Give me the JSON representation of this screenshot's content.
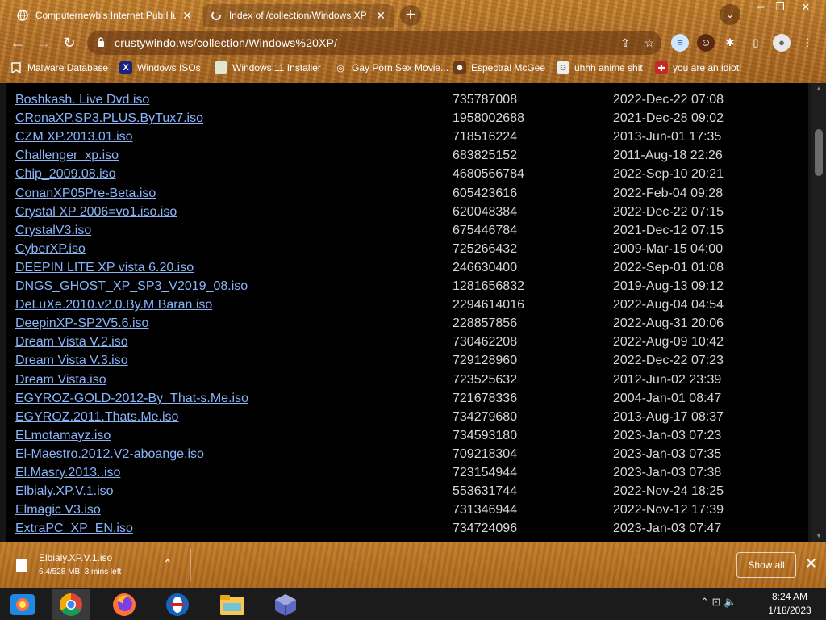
{
  "window": {
    "minimize": "─",
    "restore": "❐",
    "close": "✕"
  },
  "tabs": [
    {
      "title": "Computernewb's Internet Pub Hu",
      "close": "✕",
      "favicon": "globe-icon"
    },
    {
      "title": "Index of /collection/Windows XP",
      "close": "✕",
      "favicon": "loading-icon"
    }
  ],
  "toolbar": {
    "new_tab": "+",
    "tab_search": "⌄",
    "back": "←",
    "forward": "→",
    "reload": "↻",
    "url": "crustywindo.ws/collection/Windows%20XP/",
    "share": "⇪",
    "star": "☆",
    "extensions": "✱",
    "sidebar": "▯",
    "profile": "●",
    "menu": "⋮"
  },
  "bookmarks": [
    {
      "label": "Malware Database",
      "icon": "bookmark-icon"
    },
    {
      "label": "Windows ISOs",
      "icon": "x-logo-icon"
    },
    {
      "label": "Windows 11 Installer",
      "icon": "image-icon"
    },
    {
      "label": "Gay Porn Sex Movie...",
      "icon": "globe-icon"
    },
    {
      "label": "Espectral McGee",
      "icon": "avatar-icon"
    },
    {
      "label": "uhhh anime shit",
      "icon": "avatar-icon"
    },
    {
      "label": "you are an idiot!",
      "icon": "flag-icon"
    }
  ],
  "listing": [
    {
      "name": "Boshkash. Live Dvd.iso",
      "size": "735787008",
      "date": "2022-Dec-22 07:08"
    },
    {
      "name": "CRonaXP.SP3.PLUS.ByTux7.iso",
      "size": "1958002688",
      "date": "2021-Dec-28 09:02"
    },
    {
      "name": "CZM XP.2013.01.iso",
      "size": "718516224",
      "date": "2013-Jun-01 17:35"
    },
    {
      "name": "Challenger_xp.iso",
      "size": "683825152",
      "date": "2011-Aug-18 22:26"
    },
    {
      "name": "Chip_2009.08.iso",
      "size": "4680566784",
      "date": "2022-Sep-10 20:21"
    },
    {
      "name": "ConanXP05Pre-Beta.iso",
      "size": "605423616",
      "date": "2022-Feb-04 09:28"
    },
    {
      "name": "Crystal XP 2006=vo1.iso.iso",
      "size": "620048384",
      "date": "2022-Dec-22 07:15"
    },
    {
      "name": "CrystalV3.iso",
      "size": "675446784",
      "date": "2021-Dec-12 07:15"
    },
    {
      "name": "CyberXP.iso",
      "size": "725266432",
      "date": "2009-Mar-15 04:00"
    },
    {
      "name": "DEEPIN LITE XP vista 6.20.iso",
      "size": "246630400",
      "date": "2022-Sep-01 01:08"
    },
    {
      "name": "DNGS_GHOST_XP_SP3_V2019_08.iso",
      "size": "1281656832",
      "date": "2019-Aug-13 09:12"
    },
    {
      "name": "DeLuXe.2010.v2.0.By.M.Baran.iso",
      "size": "2294614016",
      "date": "2022-Aug-04 04:54"
    },
    {
      "name": "DeepinXP-SP2V5.6.iso",
      "size": "228857856",
      "date": "2022-Aug-31 20:06"
    },
    {
      "name": "Dream Vista V.2.iso",
      "size": "730462208",
      "date": "2022-Aug-09 10:42"
    },
    {
      "name": "Dream Vista V.3.iso",
      "size": "729128960",
      "date": "2022-Dec-22 07:23"
    },
    {
      "name": "Dream Vista.iso",
      "size": "723525632",
      "date": "2012-Jun-02 23:39"
    },
    {
      "name": "EGYROZ-GOLD-2012-By_That-s.Me.iso",
      "size": "721678336",
      "date": "2004-Jan-01 08:47"
    },
    {
      "name": "EGYROZ.2011.Thats.Me.iso",
      "size": "734279680",
      "date": "2013-Aug-17 08:37"
    },
    {
      "name": "ELmotamayz.iso",
      "size": "734593180",
      "date": "2023-Jan-03 07:23"
    },
    {
      "name": "El-Maestro.2012.V2-aboange.iso",
      "size": "709218304",
      "date": "2023-Jan-03 07:35"
    },
    {
      "name": "El.Masry.2013..iso",
      "size": "723154944",
      "date": "2023-Jan-03 07:38"
    },
    {
      "name": "Elbialy.XP.V.1.iso",
      "size": "553631744",
      "date": "2022-Nov-24 18:25"
    },
    {
      "name": "Elmagic V3.iso",
      "size": "731346944",
      "date": "2022-Nov-12 17:39"
    },
    {
      "name": "ExtraPC_XP_EN.iso",
      "size": "734724096",
      "date": "2023-Jan-03 07:47"
    }
  ],
  "download": {
    "filename": "Elbialy.XP.V.1.iso",
    "progress_text": "6.4/528 MB, 3 mins left",
    "progress_fraction": 0.012,
    "expand": "⌃",
    "show_all": "Show all",
    "close": "✕"
  },
  "taskbar": {
    "apps": [
      "start-icon",
      "chrome-icon",
      "firefox-icon",
      "opera-icon",
      "file-explorer-icon",
      "virtualbox-icon"
    ],
    "tray": "⌃  ⊡  🔈",
    "time": "8:24 AM",
    "date": "1/18/2023"
  },
  "colors": {
    "link": "#8ab4f8",
    "page_bg": "#000000",
    "theme_wood": "#b8742a"
  }
}
